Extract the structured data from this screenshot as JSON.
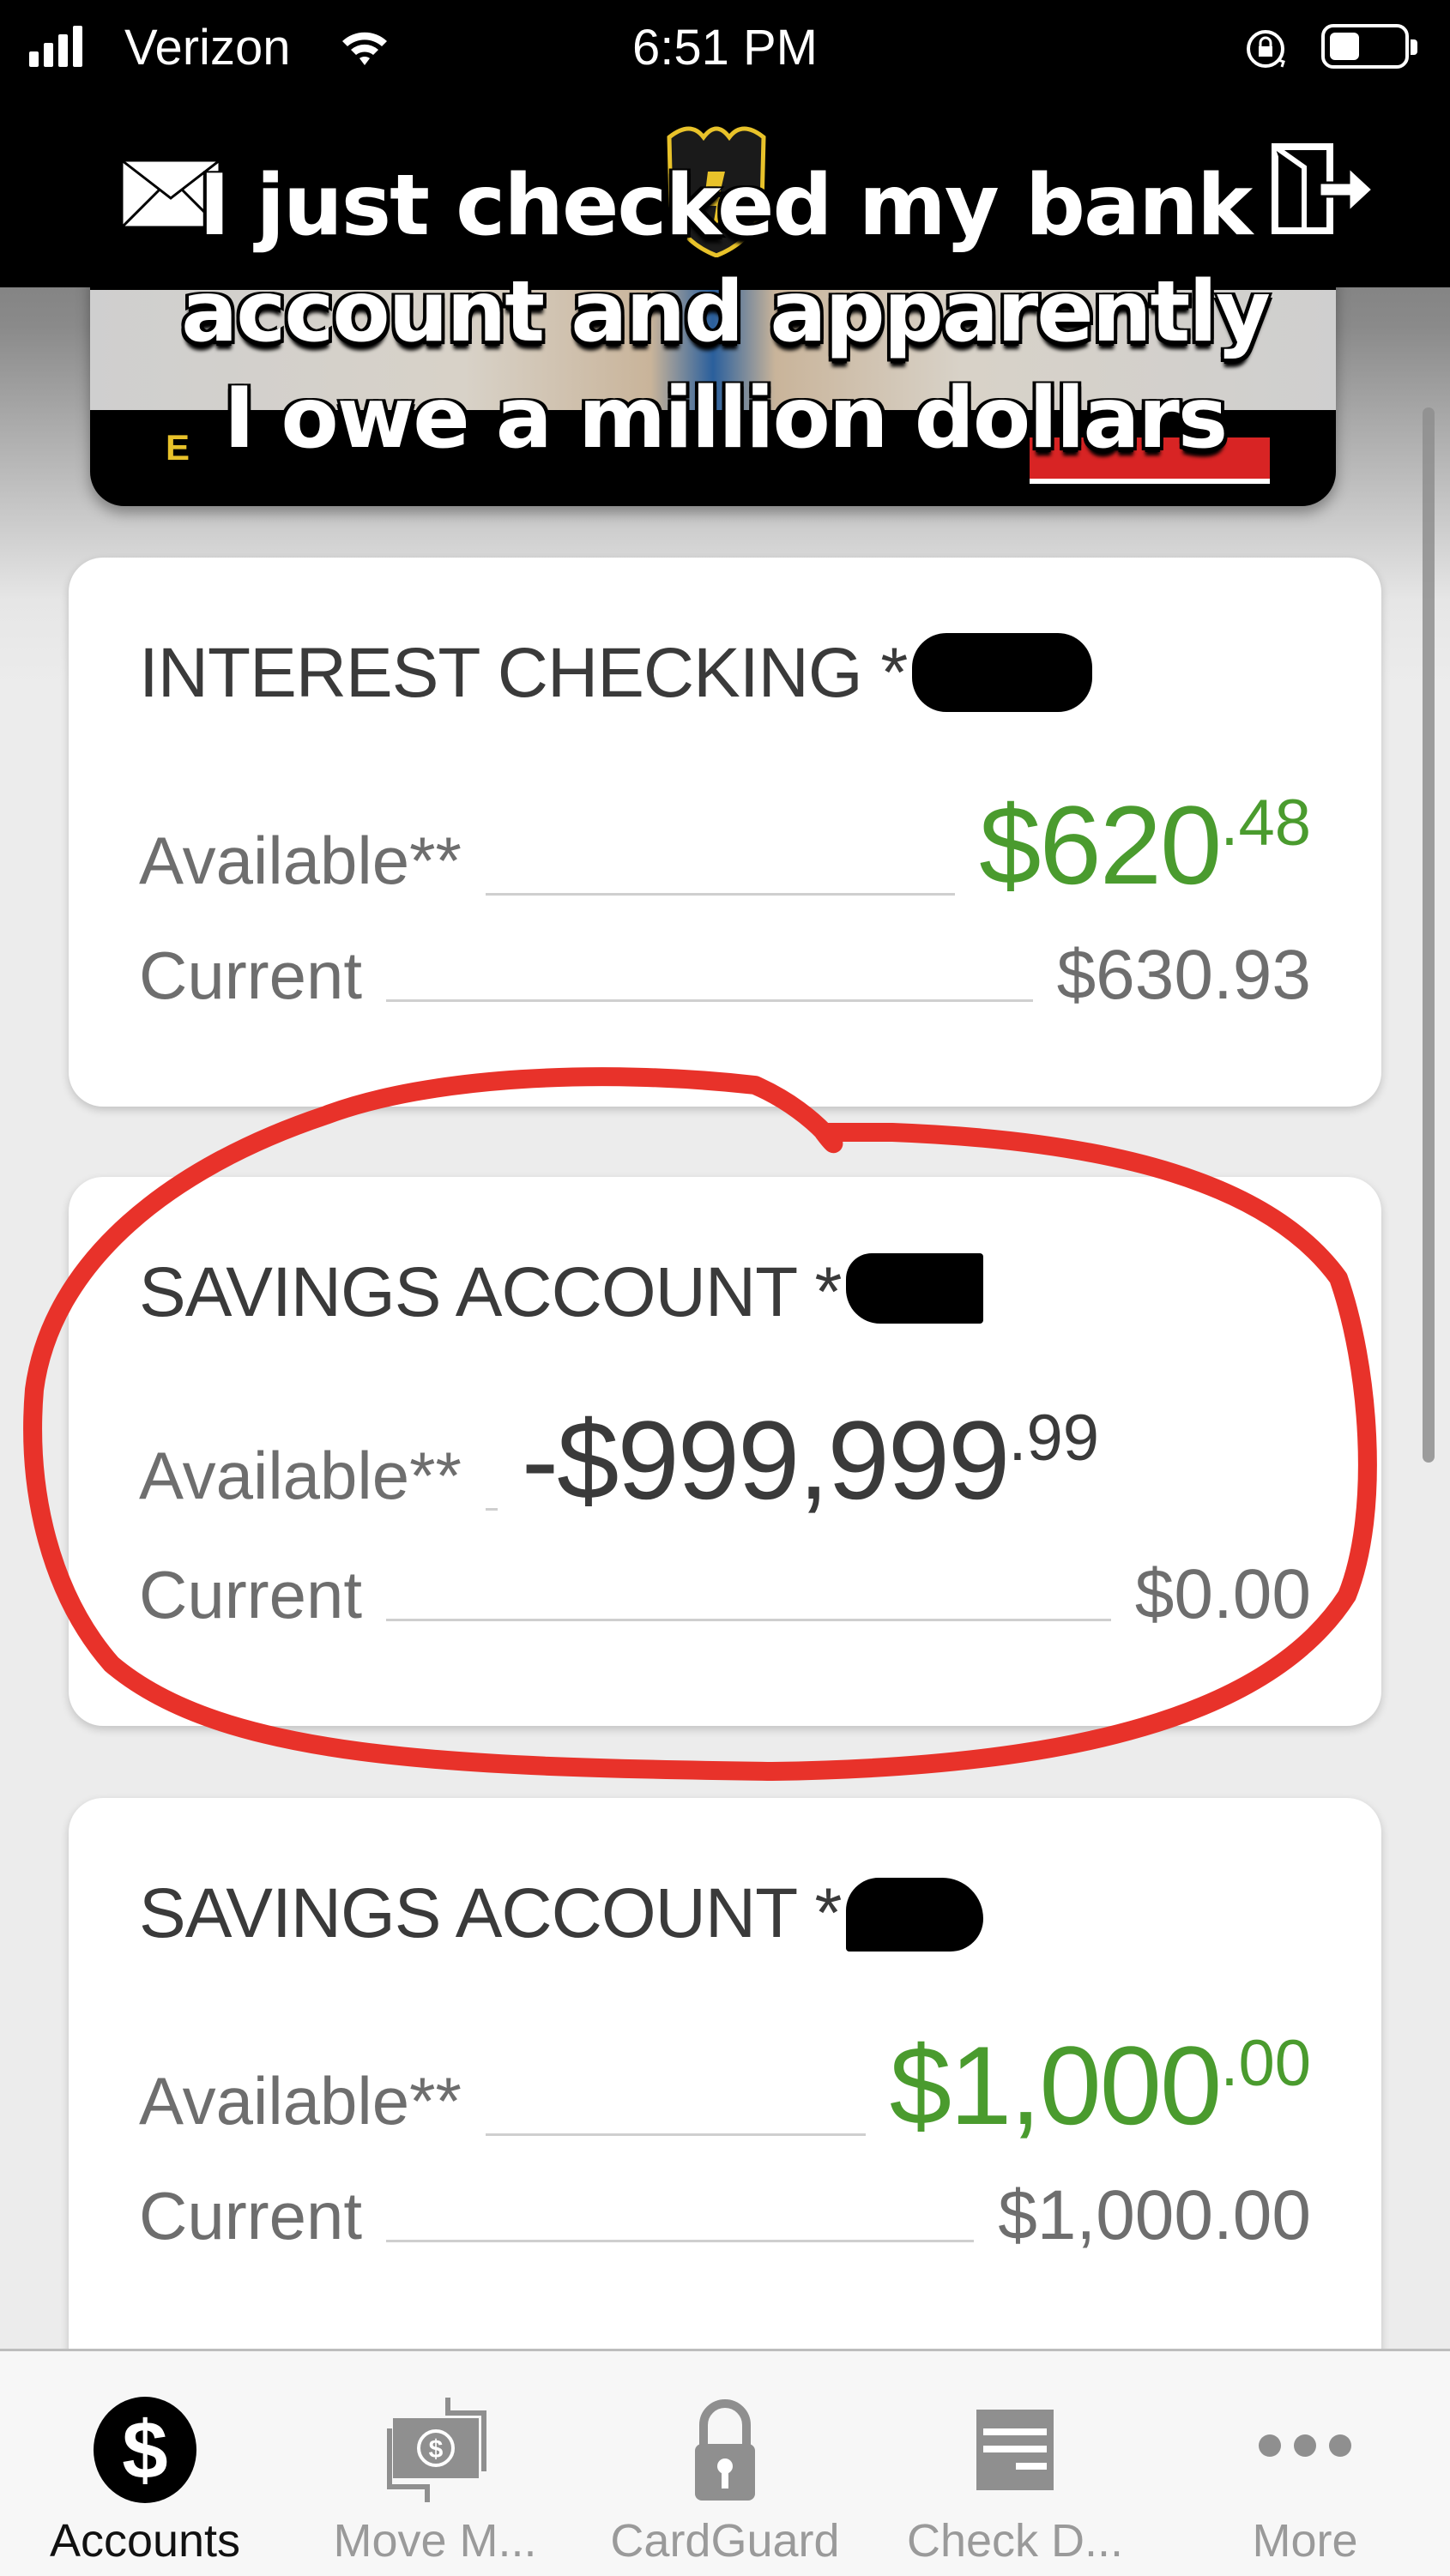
{
  "status_bar": {
    "carrier": "Verizon",
    "time": "6:51 PM",
    "signal_bars": 4,
    "icons": [
      "signal-icon",
      "wifi-icon",
      "orientation-lock-icon",
      "battery-icon"
    ]
  },
  "header": {
    "left_icon": "mail-icon",
    "right_icon": "logout-icon",
    "logo": "shield-logo"
  },
  "meme_caption": {
    "line1": "I just checked my bank",
    "line2": "account and apparently",
    "line3": "I owe a million dollars"
  },
  "banner": {
    "ad_text": "E"
  },
  "accounts": [
    {
      "name": "INTEREST CHECKING",
      "mask": "*",
      "available_label": "Available**",
      "available_main": "$620",
      "available_cents": ".48",
      "available_color": "#4a9b2e",
      "current_label": "Current",
      "current_value": "$630.93"
    },
    {
      "name": "SAVINGS ACCOUNT",
      "mask": "*",
      "available_label": "Available**",
      "available_main": "-$999,999",
      "available_cents": ".99",
      "available_color": "#3a3a3a",
      "current_label": "Current",
      "current_value": "$0.00",
      "highlighted": true
    },
    {
      "name": "SAVINGS ACCOUNT",
      "mask": "*",
      "available_label": "Available**",
      "available_main": "$1,000",
      "available_cents": ".00",
      "available_color": "#4a9b2e",
      "current_label": "Current",
      "current_value": "$1,000.00"
    }
  ],
  "tabbar": {
    "tabs": [
      {
        "label": "Accounts",
        "icon": "dollar-circle-icon",
        "active": true
      },
      {
        "label": "Move M...",
        "icon": "money-transfer-icon",
        "active": false
      },
      {
        "label": "CardGuard",
        "icon": "padlock-icon",
        "active": false
      },
      {
        "label": "Check D...",
        "icon": "check-deposit-icon",
        "active": false
      },
      {
        "label": "More",
        "icon": "more-dots-icon",
        "active": false
      }
    ]
  },
  "colors": {
    "positive_green": "#4a9b2e",
    "annotation_red": "#e8322a",
    "active_tab": "#111111",
    "inactive_tab": "#9a9a9a"
  }
}
